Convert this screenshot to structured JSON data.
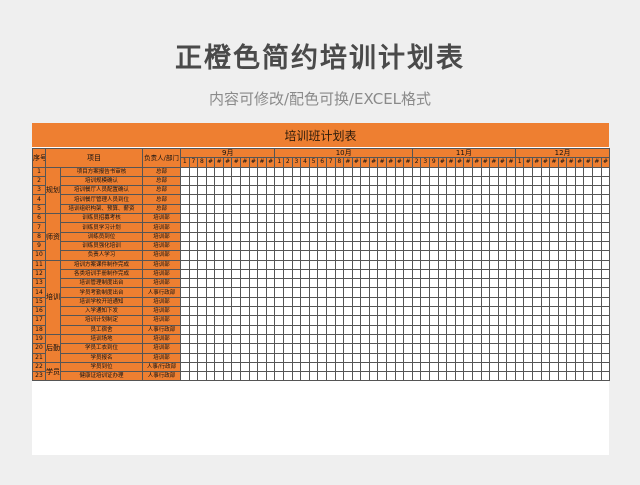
{
  "page": {
    "title": "正橙色简约培训计划表",
    "subtitle": "内容可修改/配色可换/EXCEL格式"
  },
  "sheet": {
    "banner": "培训班计划表",
    "headers": {
      "seq": "序号",
      "item": "项目",
      "owner": "负责人/部门"
    },
    "months": [
      {
        "label": "9月",
        "days": [
          "1",
          "7",
          "8",
          "#",
          "#",
          "#",
          "#",
          "#",
          "#",
          "#",
          "#"
        ]
      },
      {
        "label": "10月",
        "days": [
          "1",
          "2",
          "3",
          "4",
          "5",
          "6",
          "7",
          "8",
          "#",
          "#",
          "#",
          "#",
          "#",
          "#",
          "#",
          "#"
        ]
      },
      {
        "label": "11月",
        "days": [
          "2",
          "3",
          "9",
          "#",
          "#",
          "#",
          "#",
          "#",
          "#",
          "#",
          "#",
          "#"
        ]
      },
      {
        "label": "12月",
        "days": [
          "1",
          "#",
          "#",
          "#",
          "#",
          "#",
          "#",
          "#",
          "#",
          "#",
          "#"
        ]
      }
    ],
    "categories": [
      {
        "name": "规划",
        "start": 0,
        "span": 5
      },
      {
        "name": "师资",
        "start": 5,
        "span": 5
      },
      {
        "name": "培训",
        "start": 10,
        "span": 8
      },
      {
        "name": "后勤",
        "start": 18,
        "span": 3
      },
      {
        "name": "学员",
        "start": 21,
        "span": 3
      }
    ],
    "rows": [
      {
        "no": "1",
        "task": "项目方案报告书审核",
        "owner": "总部"
      },
      {
        "no": "2",
        "task": "培训规模确认",
        "owner": "总部"
      },
      {
        "no": "3",
        "task": "培训餐厅人员配置确认",
        "owner": "总部"
      },
      {
        "no": "4",
        "task": "培训餐厅管理人员到位",
        "owner": "总部"
      },
      {
        "no": "5",
        "task": "培训组织构架、预算、薪资",
        "owner": "总部"
      },
      {
        "no": "6",
        "task": "训练员招募考核",
        "owner": "培训部"
      },
      {
        "no": "7",
        "task": "训练员学习计划",
        "owner": "培训部"
      },
      {
        "no": "8",
        "task": "训练员到位",
        "owner": "培训部"
      },
      {
        "no": "9",
        "task": "训练员强化培训",
        "owner": "培训部"
      },
      {
        "no": "10",
        "task": "负责人学习",
        "owner": "培训部"
      },
      {
        "no": "11",
        "task": "培训方案课件制作完成",
        "owner": "培训部"
      },
      {
        "no": "12",
        "task": "各类培训手册制作完成",
        "owner": "培训部"
      },
      {
        "no": "13",
        "task": "培训管理制度出台",
        "owner": "培训部"
      },
      {
        "no": "14",
        "task": "学员考勤制度出台",
        "owner": "人事行政部"
      },
      {
        "no": "15",
        "task": "培训学校开班通知",
        "owner": "培训部"
      },
      {
        "no": "16",
        "task": "入学通知下发",
        "owner": "培训部"
      },
      {
        "no": "17",
        "task": "培训计划制定",
        "owner": "培训部"
      },
      {
        "no": "18",
        "task": "员工宿舍",
        "owner": "人事行政部"
      },
      {
        "no": "19",
        "task": "培训场地",
        "owner": "培训部"
      },
      {
        "no": "20",
        "task": "学员工衣到位",
        "owner": "培训部"
      },
      {
        "no": "21",
        "task": "学员报名",
        "owner": "培训部"
      },
      {
        "no": "22",
        "task": "学员到位",
        "owner": "人事/行政部"
      },
      {
        "no": "23",
        "task": "健康证培训证办理",
        "owner": "人事行政部"
      }
    ]
  }
}
